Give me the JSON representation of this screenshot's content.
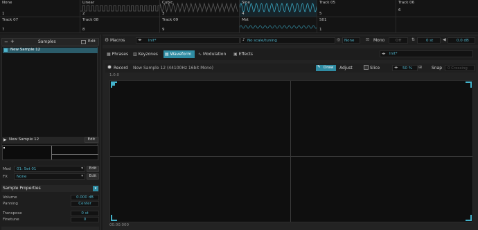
{
  "tracks": {
    "row1": [
      {
        "name": "None",
        "num": "1",
        "wave": "none"
      },
      {
        "name": "Linear",
        "num": "2",
        "wave": "square"
      },
      {
        "name": "Cubic",
        "num": "3",
        "wave": "tri"
      },
      {
        "name": "Sine",
        "num": "4",
        "wave": "sine"
      },
      {
        "name": "Track 05",
        "num": "5",
        "wave": "none"
      },
      {
        "name": "Track 06",
        "num": "6",
        "wave": "none"
      }
    ],
    "row2": [
      {
        "name": "Track 07",
        "num": "7"
      },
      {
        "name": "Track 08",
        "num": "8"
      },
      {
        "name": "Track 09",
        "num": "9"
      },
      {
        "name": "Mst",
        "num": ""
      },
      {
        "name": "S01",
        "num": "1"
      }
    ]
  },
  "samples": {
    "title": "Samples",
    "minus": "−",
    "plus": "+",
    "edit_label": "Edit",
    "selected_item": "New Sample 12",
    "preview_name": "New Sample 12",
    "preview_edit": "Edit"
  },
  "mod_fx": {
    "mod_label": "Mod",
    "mod_value": "01: Set 01",
    "mod_edit": "Edit",
    "fx_label": "FX",
    "fx_value": "None",
    "fx_edit": "Edit"
  },
  "sample_props": {
    "title": "Sample Properties",
    "volume_label": "Volume",
    "volume_value": "0.000 dB",
    "panning_label": "Panning",
    "panning_value": "Center",
    "transpose_label": "Transpose",
    "transpose_value": "0 st",
    "finetune_label": "Finetune",
    "finetune_value": "0"
  },
  "top_controls": {
    "macros_label": "Macros",
    "preset": "Init*",
    "scale": "No scale/tuning",
    "scale_none": "None",
    "mono_label": "Mono",
    "mono_value": "Off",
    "transpose": "0 st",
    "volume": "0.0 dB"
  },
  "tabs": [
    {
      "label": "Phrases",
      "icon": "phrases"
    },
    {
      "label": "Keyzones",
      "icon": "keyzones"
    },
    {
      "label": "Waveform",
      "icon": "waveform"
    },
    {
      "label": "Modulation",
      "icon": "modulation"
    },
    {
      "label": "Effects",
      "icon": "effects"
    }
  ],
  "right_preset": "Init*",
  "waveform_toolbar": {
    "record": "Record",
    "sample_info": "New Sample 12 (44100Hz 16bit Mono)",
    "draw": "Draw",
    "adjust": "Adjust",
    "slice": "Slice",
    "zoom": "50 %",
    "snap": "Snap",
    "snap_value": "0 Crossing"
  },
  "waveform": {
    "amp_label": "1.0.0",
    "time_label": "00.00.000"
  },
  "colors": {
    "accent": "#2f8ca3",
    "accent_text": "#4fb5cc"
  }
}
